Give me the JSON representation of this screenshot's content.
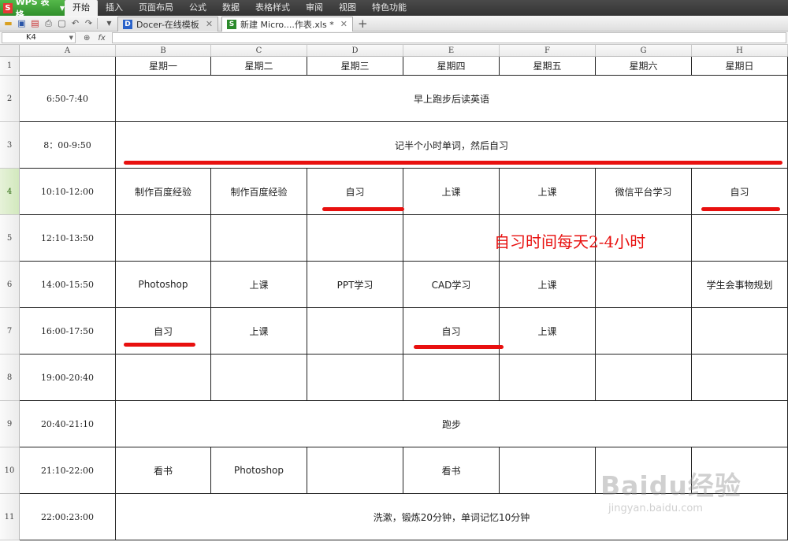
{
  "app": {
    "name": "WPS 表格",
    "logo_letter": "S",
    "menu": [
      "开始",
      "插入",
      "页面布局",
      "公式",
      "数据",
      "表格样式",
      "审阅",
      "视图",
      "特色功能"
    ],
    "active_menu": "开始"
  },
  "tabs": [
    {
      "icon": "D",
      "label": "Docer-在线模板",
      "icon_color": "#2a62c9"
    },
    {
      "icon": "S",
      "label": "新建 Micro....作表.xls *",
      "icon_color": "#2c8b2c"
    }
  ],
  "formula_bar": {
    "cell_ref": "K4",
    "fx": "fx",
    "value": ""
  },
  "columns": [
    "A",
    "B",
    "C",
    "D",
    "E",
    "F",
    "G",
    "H"
  ],
  "rows": [
    "1",
    "2",
    "3",
    "4",
    "5",
    "6",
    "7",
    "8",
    "9",
    "10",
    "11"
  ],
  "active_row": "4",
  "header": [
    "",
    "星期一",
    "星期二",
    "星期三",
    "星期四",
    "星期五",
    "星期六",
    "星期日"
  ],
  "times": [
    "6:50-7:40",
    "8：00-9:50",
    "10:10-12:00",
    "12:10-13:50",
    "14:00-15:50",
    "16:00-17:50",
    "19:00-20:40",
    "20:40-21:10",
    "21:10-22:00",
    "22:00:23:00"
  ],
  "merged_rows": {
    "0": "早上跑步后读英语",
    "1": "记半个小时单词，然后自习",
    "7": "跑步",
    "9": "洗漱，锻炼20分钟，单词记忆10分钟"
  },
  "schedule": {
    "2": [
      "制作百度经验",
      "制作百度经验",
      "自习",
      "上课",
      "上课",
      "微信平台学习",
      "自习"
    ],
    "3": [
      "",
      "",
      "",
      "",
      "",
      "",
      ""
    ],
    "4": [
      "Photoshop",
      "上课",
      "PPT学习",
      "CAD学习",
      "上课",
      "",
      "学生会事物规划"
    ],
    "5": [
      "自习",
      "上课",
      "",
      "自习",
      "上课",
      "",
      ""
    ],
    "6": [
      "",
      "",
      "",
      "",
      "",
      "",
      ""
    ],
    "8": [
      "看书",
      "Photoshop",
      "",
      "看书",
      "",
      "",
      ""
    ]
  },
  "annotation": "自习时间每天2-4小时",
  "watermark": {
    "main": "Baidu经验",
    "sub": "jingyan.baidu.com"
  },
  "colors": {
    "annotation": "#e8100f",
    "menu_active": "#f3f3f3",
    "app_green": "#2f8f2b"
  }
}
